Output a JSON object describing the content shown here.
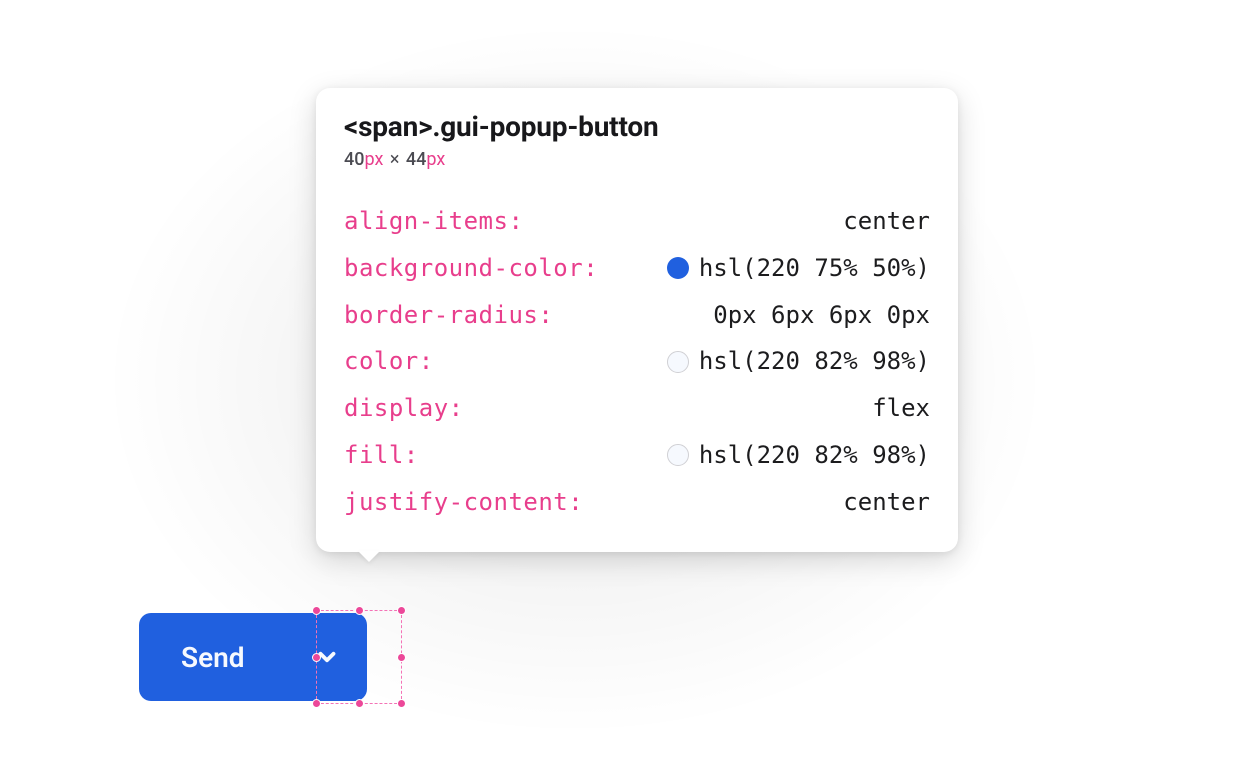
{
  "tooltip": {
    "selector": "<span>.gui-popup-button",
    "dims": {
      "w": "40",
      "wunit": "px",
      "times": "×",
      "h": "44",
      "hunit": "px"
    },
    "props": [
      {
        "name": "align-items:",
        "value": "center",
        "swatch": null
      },
      {
        "name": "background-color:",
        "value": "hsl(220 75% 50%)",
        "swatch": "blue"
      },
      {
        "name": "border-radius:",
        "value": "0px 6px 6px 0px",
        "swatch": null
      },
      {
        "name": "color:",
        "value": "hsl(220 82% 98%)",
        "swatch": "white"
      },
      {
        "name": "display:",
        "value": "flex",
        "swatch": null
      },
      {
        "name": "fill:",
        "value": "hsl(220 82% 98%)",
        "swatch": "white"
      },
      {
        "name": "justify-content:",
        "value": "center",
        "swatch": null
      }
    ]
  },
  "button": {
    "send_label": "Send"
  },
  "colors": {
    "accent": "hsl(220 75% 50%)",
    "on_accent": "hsl(220 82% 98%)",
    "prop_name": "#e83e8c",
    "selection": "#ec4899"
  }
}
